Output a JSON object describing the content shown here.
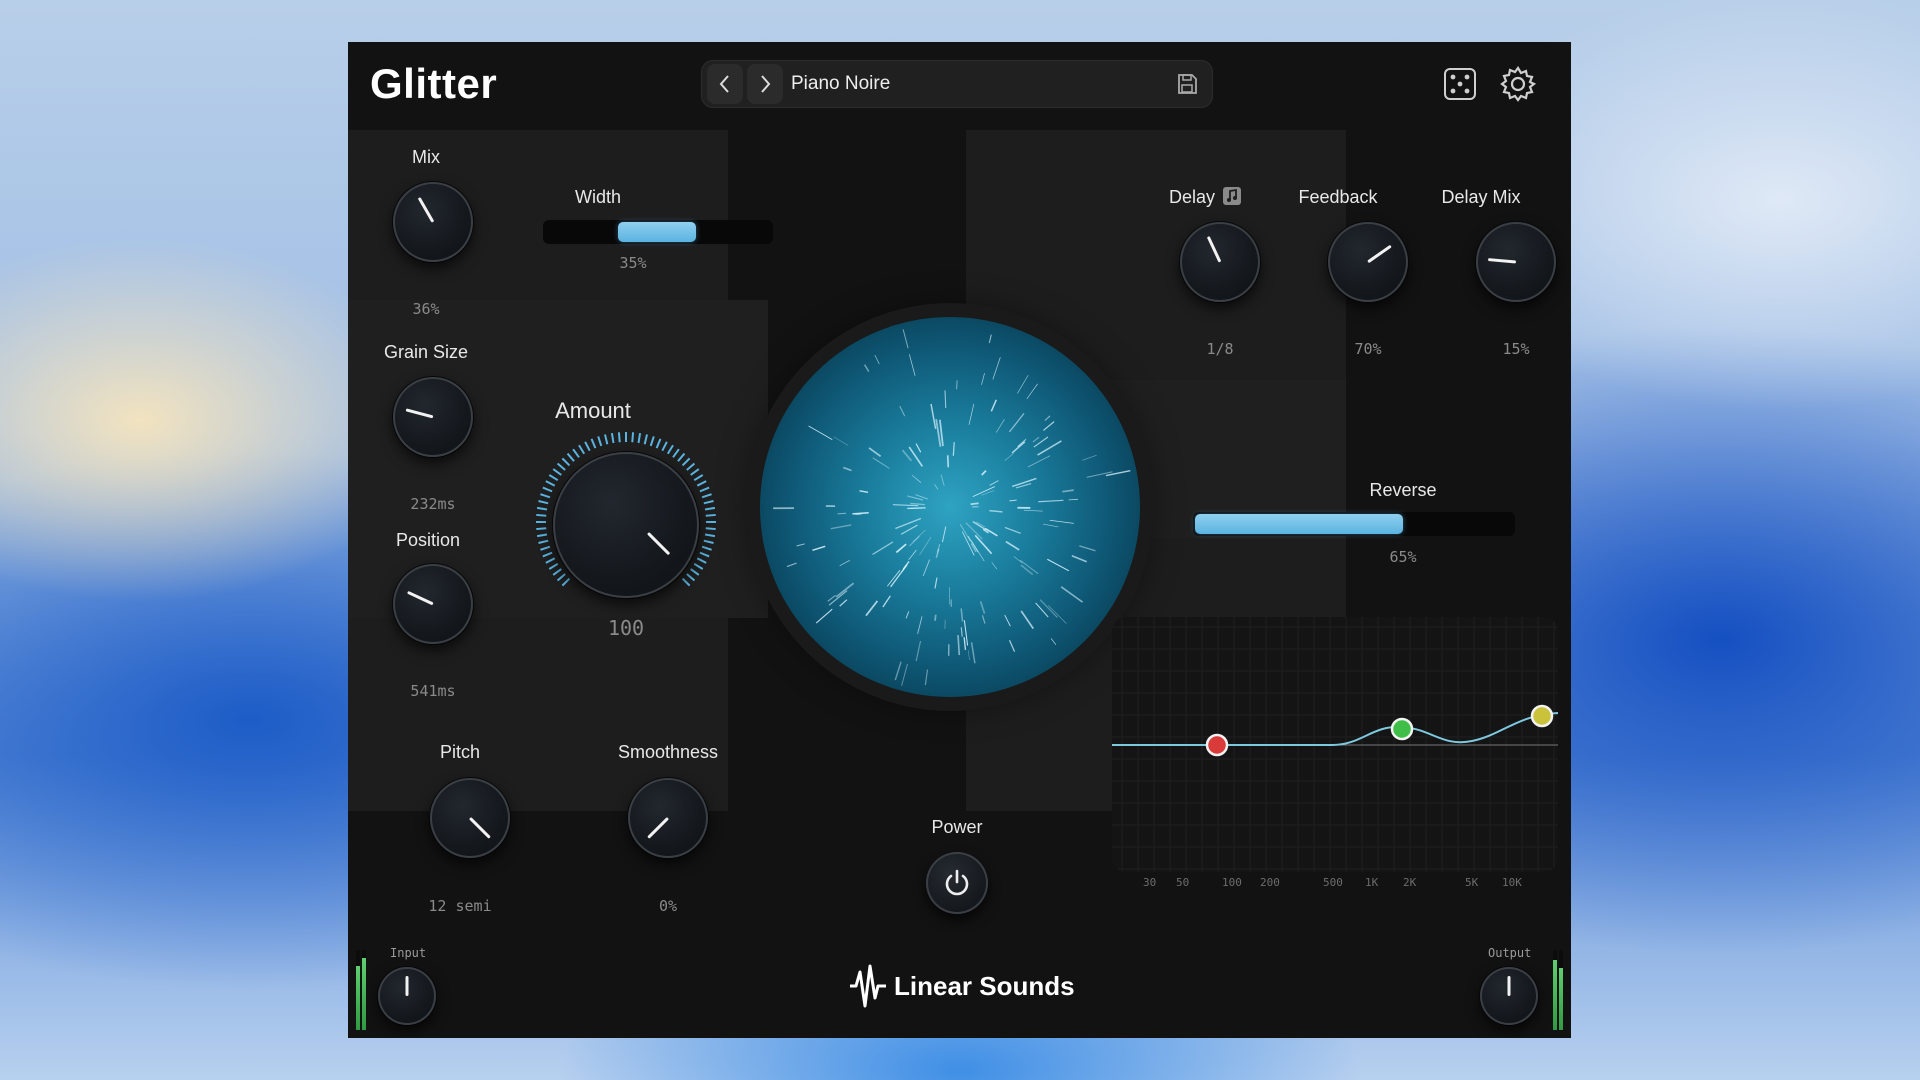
{
  "header": {
    "title": "Glitter",
    "preset_name": "Piano Noire",
    "prev_icon": "chevron-left-icon",
    "next_icon": "chevron-right-icon",
    "save_icon": "save-icon",
    "randomize_icon": "dice-icon",
    "settings_icon": "gear-icon"
  },
  "controls": {
    "mix": {
      "label": "Mix",
      "value": "36%",
      "level": 0.36
    },
    "width": {
      "label": "Width",
      "value": "35%",
      "level": 0.35
    },
    "grain_size": {
      "label": "Grain Size",
      "value": "232ms"
    },
    "position": {
      "label": "Position",
      "value": "541ms"
    },
    "amount": {
      "label": "Amount",
      "value": "100",
      "level": 1.0
    },
    "pitch": {
      "label": "Pitch",
      "value": "12 semi"
    },
    "smoothness": {
      "label": "Smoothness",
      "value": "0%",
      "level": 0.0
    },
    "delay": {
      "label": "Delay",
      "value": "1/8",
      "sync_icon": "note-icon"
    },
    "feedback": {
      "label": "Feedback",
      "value": "70%",
      "level": 0.7
    },
    "delay_mix": {
      "label": "Delay Mix",
      "value": "15%",
      "level": 0.15
    },
    "reverse": {
      "label": "Reverse",
      "value": "65%",
      "level": 0.65
    },
    "power": {
      "label": "Power",
      "icon": "power-icon"
    }
  },
  "eq": {
    "freq_labels": [
      "30",
      "50",
      "100",
      "200",
      "500",
      "1K",
      "2K",
      "5K",
      "10K"
    ],
    "nodes": [
      {
        "color": "#d93a3a"
      },
      {
        "color": "#3fbf4a"
      },
      {
        "color": "#c9c23a"
      }
    ],
    "curve_color": "#7ec8e0"
  },
  "footer": {
    "input_label": "Input",
    "output_label": "Output",
    "brand": "Linear Sounds",
    "brand_icon": "waveform-logo-icon"
  },
  "colors": {
    "accent": "#5ab3e0",
    "meter": "#3fbf4a",
    "panel": "#1d1d1d"
  }
}
